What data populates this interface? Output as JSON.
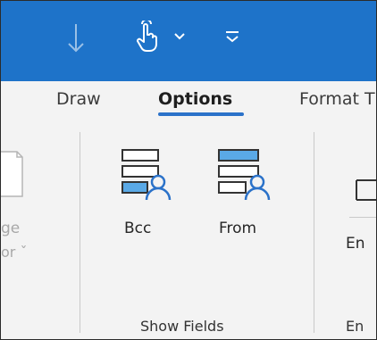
{
  "tabs": {
    "draw": "Draw",
    "options": "Options",
    "format": "Format T"
  },
  "ribbon": {
    "left_partial": {
      "line1": "ge",
      "line2": "or ˇ"
    },
    "bcc_label": "Bcc",
    "from_label": "From",
    "show_fields_group": "Show Fields",
    "right_partial_top": "En",
    "right_partial_bottom": "En"
  },
  "colors": {
    "titlebar": "#1e73c9",
    "accent": "#2b72c9",
    "ribbon_bg": "#f3f3f3"
  },
  "icons": {
    "undo": "arrow-down-icon",
    "touch_mode": "touch-mode-icon",
    "dropdown": "chevron-down-icon",
    "customize": "customize-qat-icon",
    "bcc": "bcc-field-icon",
    "from": "from-field-icon"
  }
}
